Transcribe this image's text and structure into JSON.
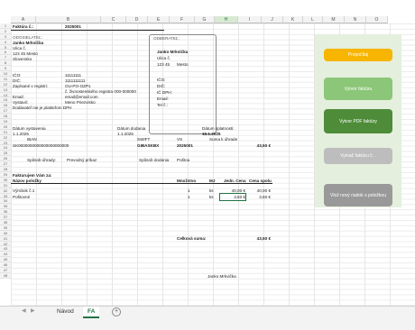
{
  "columns": [
    "A",
    "B",
    "C",
    "D",
    "E",
    "F",
    "G",
    "H",
    "I",
    "J",
    "K",
    "L",
    "M",
    "N",
    "O"
  ],
  "rows": [
    "1",
    "2",
    "3",
    "4",
    "5",
    "6",
    "7",
    "8",
    "9",
    "10",
    "11",
    "12",
    "13",
    "14",
    "15",
    "16",
    "17",
    "18",
    "19",
    "20",
    "21",
    "22",
    "23",
    "24",
    "25",
    "26",
    "27",
    "28",
    "29",
    "30",
    "31",
    "32",
    "33",
    "34",
    "35",
    "36",
    "37",
    "38",
    "39",
    "40",
    "41",
    "42",
    "43",
    "44",
    "45",
    "46",
    "47",
    "48"
  ],
  "invoice": {
    "label": "Faktúra č.:",
    "number": "2025001"
  },
  "supplier": {
    "title": "ODOSIELATEĽ:",
    "name": "Janko Mrkvička",
    "street": "Ulica č.",
    "city": "123 45 Mesto",
    "country": "Slovensko",
    "ico_label": "IČO:",
    "ico": "11111111",
    "dic_label": "DIČ:",
    "dic": "1111111111",
    "registry_label": "Zapísané v registri:",
    "registry": "OU-PO-OZP1",
    "registry2": "č. živnostenského registra 000-000000",
    "email_label": "Email:",
    "email": "email@email.com",
    "issuer_label": "Vystavil:",
    "issuer": "Meno Priezvisko",
    "vat_note": "Dodávateľ nie je platiteľom DPH"
  },
  "customer": {
    "title": "ODBERATEĽ:",
    "name": "Janko Mrkvička",
    "street": "Ulica č.",
    "zip": "123 45",
    "city": "Mesto",
    "ico_label": "IČO:",
    "dic_label": "DIČ:",
    "icdph_label": "IČ DPH:",
    "email_label": "Email:",
    "tel_label": "Tel č.:"
  },
  "dates": {
    "issued_label": "Dátum vystavenia",
    "issued": "1.1.2025",
    "delivery_label": "Dátum dodania",
    "delivery": "1.1.2025",
    "due_label": "Dátum splatnosti:",
    "due": "15.1.2025"
  },
  "payment": {
    "iban_label": "IBAN",
    "iban": "SK0000000000000000000000",
    "swift_label": "SWIFT",
    "swift": "GIBASKBX",
    "vs_label": "VS",
    "vs": "2025001",
    "sum_label": "Suma k úhrade",
    "sum": "43,50 €",
    "method_label": "Spôsob úhrady:",
    "method": "Prevodný príkaz",
    "delivery_method_label": "Spôsob dodania",
    "delivery_method": "Poštou"
  },
  "items": {
    "intro": "Fakturujem Vám za:",
    "headers": [
      "Názov položky",
      "Množstvo",
      "MJ",
      "Jedn. Cena",
      "Cena spolu"
    ],
    "rows": [
      [
        "Výrobok č.1",
        "1",
        "ks",
        "40,00 €",
        "40,00 €"
      ],
      [
        "Poštovné",
        "1",
        "ks",
        "3,50 €",
        "3,50 €"
      ]
    ],
    "total_label": "Celková suma:",
    "total": "43,50 €"
  },
  "signature": "Janko Mrkvička",
  "buttons": {
    "recalc": "Prepočítaj",
    "create": "Vytvor faktúru",
    "pdf": "Vytvor PDF faktúry",
    "delete": "Vymaž faktúru č. .",
    "add_row": "Vlož nový riadok s položkou"
  },
  "colors": {
    "recalc": "#f7b500",
    "create": "#8cc678",
    "pdf": "#4e8c3a",
    "delete": "#bdbdbd",
    "add_row": "#999999",
    "panel": "#e4efdd",
    "accent": "#217346"
  },
  "tabs": {
    "prev": "◀",
    "next": "▶",
    "tab1": "Návod",
    "tab2": "FA",
    "add": "+"
  }
}
